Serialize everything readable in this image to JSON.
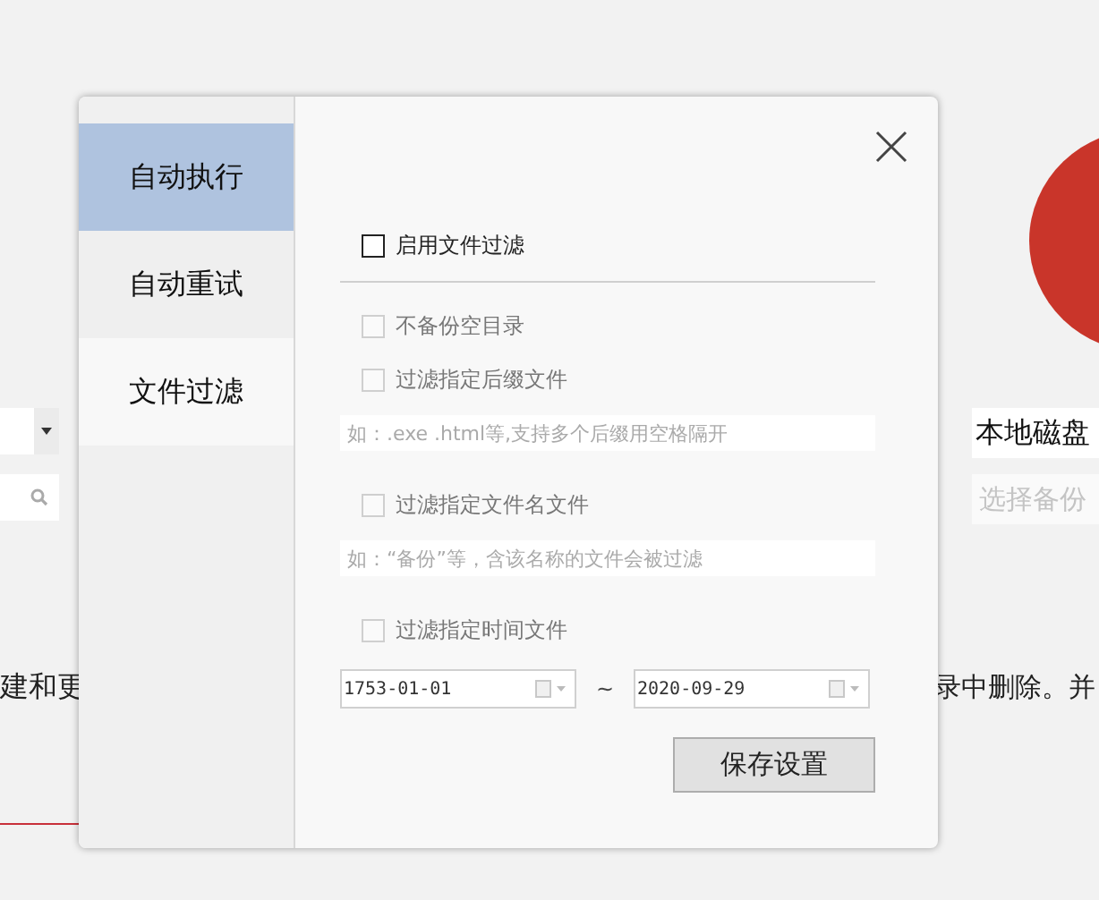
{
  "background": {
    "left_text": "建和更",
    "right_text": "录中删除。并",
    "location_field": {
      "value": "本地磁盘"
    },
    "backup_field": {
      "placeholder": "选择备份"
    }
  },
  "dialog": {
    "tabs": [
      {
        "label": "自动执行",
        "selected": true
      },
      {
        "label": "自动重试",
        "selected": false
      },
      {
        "label": "文件过滤",
        "selected": false
      }
    ],
    "enable_filter": {
      "label": "启用文件过滤",
      "checked": false
    },
    "options": [
      {
        "kind": "check",
        "label": "不备份空目录",
        "checked": false,
        "disabled": true
      },
      {
        "kind": "check",
        "label": "过滤指定后缀文件",
        "checked": false,
        "disabled": true
      },
      {
        "kind": "field",
        "placeholder": "如：.exe .html等,支持多个后缀用空格隔开"
      },
      {
        "kind": "check",
        "label": "过滤指定文件名文件",
        "checked": false,
        "disabled": true
      },
      {
        "kind": "field",
        "placeholder": "如：“备份”等，含该名称的文件会被过滤"
      },
      {
        "kind": "check",
        "label": "过滤指定时间文件",
        "checked": false,
        "disabled": true
      },
      {
        "kind": "dates",
        "from": "1753-01-01",
        "separator": "~",
        "to": "2020-09-29"
      }
    ],
    "save_button": "保存设置"
  }
}
